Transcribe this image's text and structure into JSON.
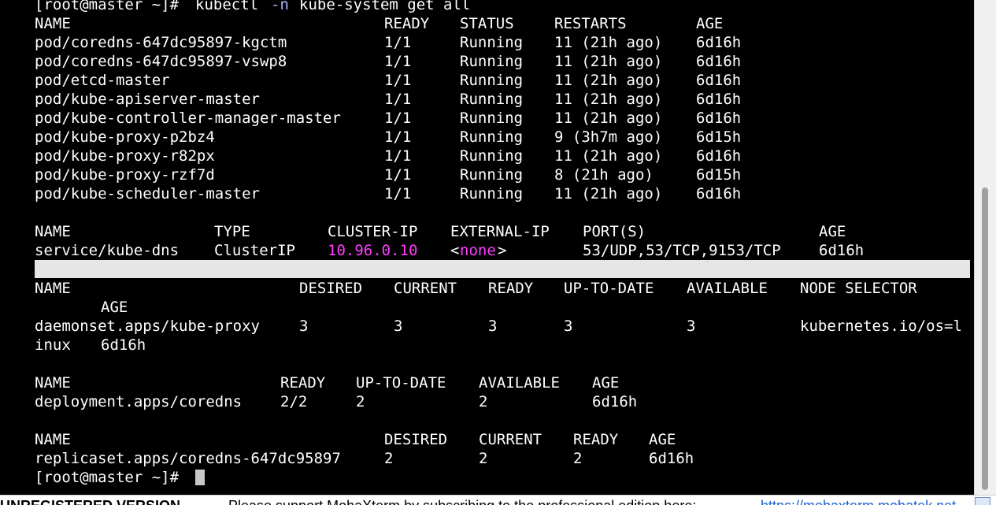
{
  "colors": {
    "terminal_bg": "#000000",
    "terminal_fg": "#ffffff",
    "cluster_ip": "#ff3cff",
    "none_value": "#ff3cff"
  },
  "terminal": {
    "command_line": "[root@master ~]# kubectl -n kube-system get all",
    "command_prompt": "[root@master ~]#",
    "command_cmd": "kubectl",
    "command_flag": "-n",
    "command_rest": "kube-system get all",
    "pods": {
      "header": [
        "NAME",
        "READY",
        "STATUS",
        "RESTARTS",
        "AGE"
      ],
      "rows": [
        [
          "pod/coredns-647dc95897-kgctm",
          "1/1",
          "Running",
          "11 (21h ago)",
          "6d16h"
        ],
        [
          "pod/coredns-647dc95897-vswp8",
          "1/1",
          "Running",
          "11 (21h ago)",
          "6d16h"
        ],
        [
          "pod/etcd-master",
          "1/1",
          "Running",
          "11 (21h ago)",
          "6d16h"
        ],
        [
          "pod/kube-apiserver-master",
          "1/1",
          "Running",
          "11 (21h ago)",
          "6d16h"
        ],
        [
          "pod/kube-controller-manager-master",
          "1/1",
          "Running",
          "11 (21h ago)",
          "6d16h"
        ],
        [
          "pod/kube-proxy-p2bz4",
          "1/1",
          "Running",
          "9 (3h7m ago)",
          "6d15h"
        ],
        [
          "pod/kube-proxy-r82px",
          "1/1",
          "Running",
          "11 (21h ago)",
          "6d16h"
        ],
        [
          "pod/kube-proxy-rzf7d",
          "1/1",
          "Running",
          "8 (21h ago)",
          "6d15h"
        ],
        [
          "pod/kube-scheduler-master",
          "1/1",
          "Running",
          "11 (21h ago)",
          "6d16h"
        ]
      ]
    },
    "services": {
      "header": [
        "NAME",
        "TYPE",
        "CLUSTER-IP",
        "EXTERNAL-IP",
        "PORT(S)",
        "AGE"
      ],
      "rows": [
        [
          "service/kube-dns",
          "ClusterIP",
          "10.96.0.10",
          "<none>",
          "53/UDP,53/TCP,9153/TCP",
          "6d16h"
        ]
      ],
      "external_open": "<",
      "external_value": "none",
      "external_close": ">"
    },
    "daemonsets": {
      "header": [
        "NAME",
        "DESIRED",
        "CURRENT",
        "READY",
        "UP-TO-DATE",
        "AVAILABLE",
        "NODE SELECTOR"
      ],
      "header_wrap": "AGE",
      "row": [
        "daemonset.apps/kube-proxy",
        "3",
        "3",
        "3",
        "3",
        "3",
        "kubernetes.io/os=l"
      ],
      "row_wrap": "inux",
      "row_wrap_age": "6d16h"
    },
    "deployments": {
      "header": [
        "NAME",
        "READY",
        "UP-TO-DATE",
        "AVAILABLE",
        "AGE"
      ],
      "row": [
        "deployment.apps/coredns",
        "2/2",
        "2",
        "2",
        "6d16h"
      ]
    },
    "replicasets": {
      "header": [
        "NAME",
        "DESIRED",
        "CURRENT",
        "READY",
        "AGE"
      ],
      "row": [
        "replicaset.apps/coredns-647dc95897",
        "2",
        "2",
        "2",
        "6d16h"
      ]
    },
    "final_prompt": "[root@master ~]#"
  },
  "statusbar": {
    "unregistered": "UNREGISTERED VERSION",
    "message": "Please support MobaXterm by subscribing to the professional edition here:",
    "link": "https://mobaxterm.mobatek.net"
  }
}
